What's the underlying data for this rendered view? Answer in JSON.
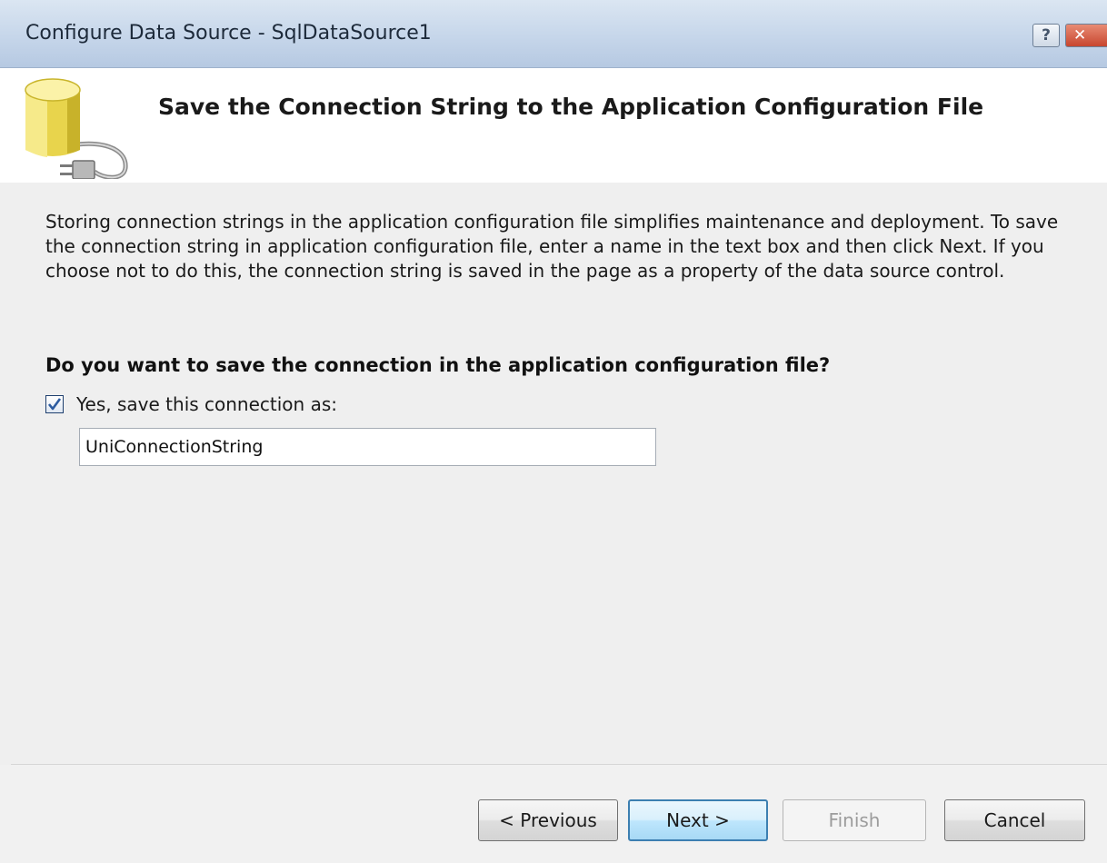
{
  "window": {
    "title": "Configure Data Source - SqlDataSource1",
    "help_label": "?",
    "close_label": "✕"
  },
  "header": {
    "title": "Save the Connection String to the Application Configuration File",
    "icon": "database-plug-icon",
    "icon_colors": {
      "cylinder": "#f0dc5a",
      "cylinder_shade": "#c9b52c",
      "plug": "#9a9a9a"
    }
  },
  "content": {
    "description": "Storing connection strings in the application configuration file simplifies maintenance and deployment. To save the connection string in application configuration file, enter a name in the text box and then click Next. If you choose not to do this, the connection string is saved in the page as a property of the data source control.",
    "question": "Do you want to save the connection in the application configuration file?",
    "save_checkbox": {
      "label": "Yes, save this connection as:",
      "checked": true
    },
    "connection_name": "UniConnectionString"
  },
  "footer": {
    "previous_label": "< Previous",
    "next_label": "Next >",
    "finish_label": "Finish",
    "cancel_label": "Cancel",
    "finish_enabled": false
  },
  "colors": {
    "titlebar": "#c6d6ea",
    "dialog_bg": "#efefef",
    "default_button_border": "#3c7fb1",
    "checkbox_check": "#2b5aa0"
  }
}
